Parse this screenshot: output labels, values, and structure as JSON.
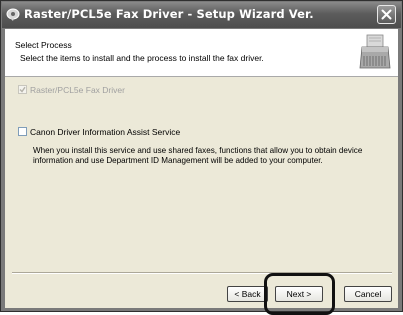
{
  "window": {
    "title": "Raster/PCL5e Fax Driver - Setup Wizard Ver. "
  },
  "header": {
    "title": "Select Process",
    "subtitle": "Select the items to install and the process to install the fax driver."
  },
  "options": [
    {
      "label": "Raster/PCL5e Fax Driver",
      "checked": true,
      "enabled": false
    },
    {
      "label": "Canon Driver Information Assist Service",
      "checked": false,
      "enabled": true,
      "description": "When you install this service and use shared faxes, functions that allow you to obtain device information and use Department ID Management will be added to your computer."
    }
  ],
  "buttons": {
    "back": "< Back",
    "next": "Next >",
    "cancel": "Cancel"
  },
  "colors": {
    "highlight_ring": "#111111",
    "disabled_text": "#a0a0a0"
  }
}
